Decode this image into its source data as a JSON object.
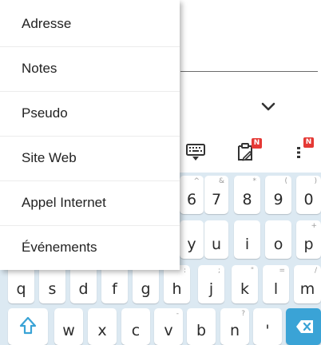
{
  "menu": {
    "items": [
      {
        "label": "Adresse"
      },
      {
        "label": "Notes"
      },
      {
        "label": "Pseudo"
      },
      {
        "label": "Site Web"
      },
      {
        "label": "Appel Internet"
      },
      {
        "label": "Événements"
      }
    ]
  },
  "toolbar": {
    "clipboard_badge": "N",
    "more_badge": "N"
  },
  "keyboard": {
    "row1": [
      {
        "label": "6",
        "sec": "^"
      },
      {
        "label": "7",
        "sec": "&"
      },
      {
        "label": "8",
        "sec": "*"
      },
      {
        "label": "9",
        "sec": "("
      },
      {
        "label": "0",
        "sec": ")"
      }
    ],
    "row2": [
      {
        "label": "y",
        "sec": ""
      },
      {
        "label": "u",
        "sec": ""
      },
      {
        "label": "i",
        "sec": ""
      },
      {
        "label": "o",
        "sec": ""
      },
      {
        "label": "p",
        "sec": "+"
      }
    ],
    "row3": [
      {
        "label": "q",
        "sec": ""
      },
      {
        "label": "s",
        "sec": ""
      },
      {
        "label": "d",
        "sec": ""
      },
      {
        "label": "f",
        "sec": ""
      },
      {
        "label": "g",
        "sec": ""
      },
      {
        "label": "h",
        "sec": ":"
      },
      {
        "label": "j",
        "sec": ";"
      },
      {
        "label": "k",
        "sec": "\""
      },
      {
        "label": "l",
        "sec": "="
      },
      {
        "label": "m",
        "sec": "/"
      }
    ],
    "row4": [
      {
        "label": "w",
        "sec": ""
      },
      {
        "label": "x",
        "sec": ""
      },
      {
        "label": "c",
        "sec": ""
      },
      {
        "label": "v",
        "sec": "-"
      },
      {
        "label": "b",
        "sec": ""
      },
      {
        "label": "n",
        "sec": "?"
      },
      {
        "label": "'",
        "sec": ""
      }
    ]
  },
  "colors": {
    "accent": "#3aa3d6",
    "keyboard_bg": "#dce9f2",
    "badge": "#e53935"
  }
}
